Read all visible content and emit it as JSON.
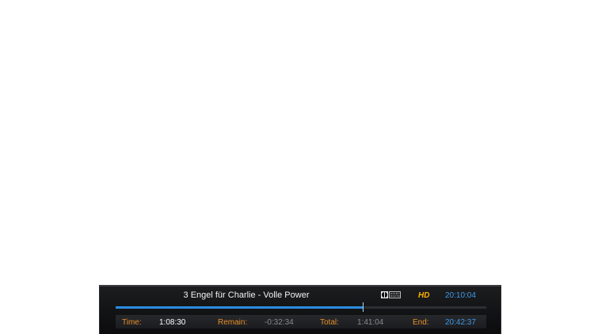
{
  "osd": {
    "title": "3 Engel für Charlie - Volle Power",
    "audio_icon": "dolby-digital-icon",
    "dolby_text": "DOLBY DIGITAL",
    "hd_badge": "HD",
    "clock": "20:10:04",
    "progress": 0.666,
    "colors": {
      "accent": "#2a8be0",
      "label": "#e8902a",
      "hd": "#ffb000"
    },
    "time_label": "Time:",
    "time_value": "1:08:30",
    "remain_label": "Remain:",
    "remain_value": "-0:32:34",
    "total_label": "Total:",
    "total_value": "1:41:04",
    "end_label": "End:",
    "end_value": "20:42:37"
  }
}
